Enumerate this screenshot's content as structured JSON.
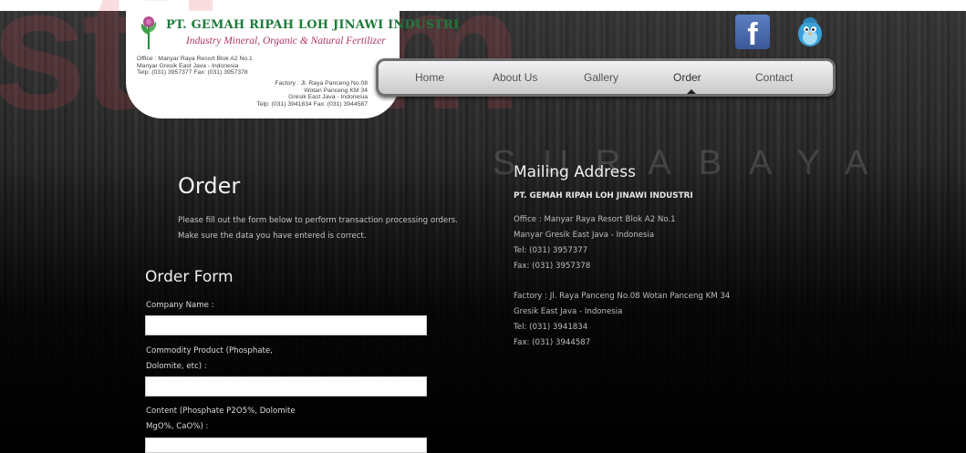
{
  "header": {
    "company_name": "PT. GEMAH RIPAH LOH JINAWI INDUSTRI",
    "tagline": "Industry Mineral, Organic & Natural Fertilizer",
    "office_lines": [
      "Office : Manyar Raya Resort Blok A2 No.1",
      "Manyar Gresik East Java - Indonesia",
      "Telp: (031) 3957377  Fax: (031) 3957378"
    ],
    "factory_lines": [
      "Factory : Jl. Raya Panceng No.08",
      "Wotan Panceng KM 34",
      "Gresik East Java - Indonesia",
      "Telp: (031) 3941834  Fax: (031) 3944587"
    ]
  },
  "watermark": {
    "main": "stikom",
    "sub": "SURABAYA"
  },
  "nav": {
    "items": [
      "Home",
      "About Us",
      "Gallery",
      "Order",
      "Contact"
    ],
    "active": "Order"
  },
  "social": {
    "facebook_glyph": "f",
    "icons": [
      "facebook-icon",
      "twitter-bird-icon"
    ]
  },
  "main": {
    "title": "Order",
    "intro_lines": [
      "Please fill out the form below to perform transaction processing orders.",
      "Make sure the data you have entered is correct."
    ]
  },
  "form": {
    "title": "Order Form",
    "fields": [
      {
        "label_lines": [
          "Company Name :"
        ],
        "value": ""
      },
      {
        "label_lines": [
          "Commodity Product (Phosphate,",
          "Dolomite, etc) :"
        ],
        "value": ""
      },
      {
        "label_lines": [
          "Content (Phosphate P2O5%, Dolomite",
          "MgO%, CaO%) :"
        ],
        "value": ""
      }
    ]
  },
  "mailing": {
    "title": "Mailing Address",
    "company": "PT. GEMAH RIPAH LOH JINAWI INDUSTRI",
    "office_lines": [
      "Office : Manyar Raya Resort Blok A2 No.1",
      "Manyar Gresik East Java - Indonesia",
      "Tel: (031) 3957377",
      "Fax: (031) 3957378"
    ],
    "factory_lines": [
      "Factory : Jl. Raya Panceng No.08 Wotan Panceng KM 34",
      "Gresik East Java - Indonesia",
      "Tel: (031) 3941834",
      "Fax: (031) 3944587"
    ]
  },
  "colors": {
    "logo_green": "#1e7a3a",
    "tagline_magenta": "#b0346a",
    "facebook_blue": "#3b5998",
    "background": "#0b0b0b"
  }
}
